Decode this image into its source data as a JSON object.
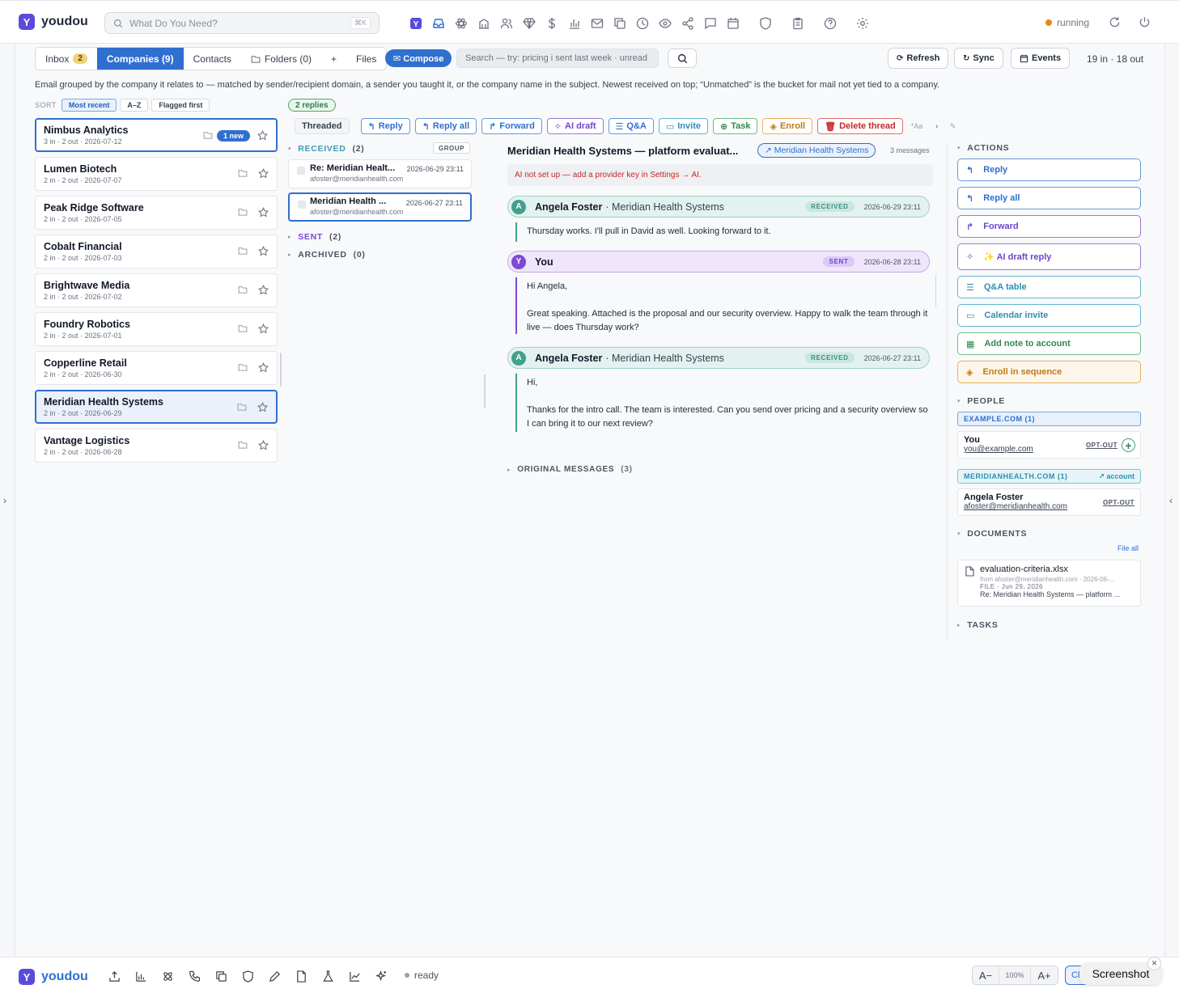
{
  "app": {
    "name": "youdou",
    "logo_letter": "Y"
  },
  "topbar": {
    "search_placeholder": "What Do You Need?",
    "search_shortcut": "⌘K",
    "status": "running",
    "icons": [
      "youdou-icon",
      "inbox-icon",
      "atom-icon",
      "building-icon",
      "users-icon",
      "gem-icon",
      "dollar-icon",
      "bar-chart-icon",
      "mail-icon",
      "copy-icon",
      "clock-icon",
      "eye-icon",
      "share-icon",
      "chat-icon",
      "calendar-icon",
      "shield-icon",
      "clipboard-icon",
      "help-icon",
      "gear-icon"
    ]
  },
  "tabs": [
    {
      "label": "Inbox",
      "badge": "2"
    },
    {
      "label": "Companies (9)"
    },
    {
      "label": "Contacts"
    },
    {
      "label": "Folders (0)"
    },
    {
      "label": "+"
    },
    {
      "label": "Files"
    }
  ],
  "compose_label": "✉ Compose",
  "mail_search_placeholder": "Search — try: pricing i sent last week · unread",
  "header_buttons": {
    "refresh": "Refresh",
    "sync": "Sync",
    "events": "Events"
  },
  "counts": "19 in · 18 out",
  "description": "Email grouped by the company it relates to — matched by sender/recipient domain, a sender you taught it, or the company name in the subject. Newest received on top; “Unmatched” is the bucket for mail not yet tied to a company.",
  "sort": {
    "label": "SORT",
    "options": [
      "Most recent",
      "A–Z",
      "Flagged first"
    ]
  },
  "companies": [
    {
      "name": "Nimbus Analytics",
      "meta": "3 in · 2 out · 2026-07-12",
      "badge": "1 new"
    },
    {
      "name": "Lumen Biotech",
      "meta": "2 in · 2 out · 2026-07-07"
    },
    {
      "name": "Peak Ridge Software",
      "meta": "2 in · 2 out · 2026-07-05"
    },
    {
      "name": "Cobalt Financial",
      "meta": "2 in · 2 out · 2026-07-03"
    },
    {
      "name": "Brightwave Media",
      "meta": "2 in · 2 out · 2026-07-02"
    },
    {
      "name": "Foundry Robotics",
      "meta": "2 in · 2 out · 2026-07-01"
    },
    {
      "name": "Copperline Retail",
      "meta": "2 in · 2 out · 2026-06-30"
    },
    {
      "name": "Meridian Health Systems",
      "meta": "2 in · 2 out · 2026-06-29"
    },
    {
      "name": "Vantage Logistics",
      "meta": "2 in · 2 out · 2026-06-28"
    }
  ],
  "thread_list": {
    "replies_badge": "2 replies",
    "actions": [
      "Threaded",
      "Reply",
      "Reply all",
      "Forward",
      "AI draft",
      "Q&A",
      "Invite",
      "Task",
      "Enroll",
      "Delete thread"
    ],
    "small_icons": [
      "*Aa",
      "◑",
      "✎"
    ],
    "received": {
      "label": "RECEIVED",
      "count": "(2)"
    },
    "group_label": "GROUP",
    "messages": [
      {
        "subject": "Re: Meridian Healt...",
        "date": "2026-06-29 23:11",
        "from": "afoster@meridianhealth.com"
      },
      {
        "subject": "Meridian Health ...",
        "date": "2026-06-27 23:11",
        "from": "afoster@meridianhealth.com"
      }
    ],
    "sent": {
      "label": "SENT",
      "count": "(2)"
    },
    "archived": {
      "label": "ARCHIVED",
      "count": "(0)"
    }
  },
  "thread": {
    "title": "Meridian Health Systems — platform evaluat...",
    "company_chip": "↗ Meridian Health Systems",
    "message_count": "3 messages",
    "ai_warning": "AI not set up — add a provider key in Settings → AI.",
    "messages": [
      {
        "avatar": "A",
        "name": "Angela Foster",
        "company": "· Meridian Health Systems",
        "tag": "RECEIVED",
        "date": "2026-06-29 23:11",
        "body": "Thursday works. I'll pull in David as well. Looking forward to it."
      },
      {
        "avatar": "Y",
        "name": "You",
        "company": "",
        "tag": "SENT",
        "date": "2026-06-28 23:11",
        "body": "Hi Angela,\n\nGreat speaking. Attached is the proposal and our security overview. Happy to walk the team through it live — does Thursday work?"
      },
      {
        "avatar": "A",
        "name": "Angela Foster",
        "company": "· Meridian Health Systems",
        "tag": "RECEIVED",
        "date": "2026-06-27 23:11",
        "body": "Hi,\n\nThanks for the intro call. The team is interested. Can you send over pricing and a security overview so I can bring it to our next review?"
      }
    ],
    "original": {
      "label": "ORIGINAL MESSAGES",
      "count": "(3)"
    }
  },
  "sidebar": {
    "actions_label": "ACTIONS",
    "actions": [
      "Reply",
      "Reply all",
      "Forward",
      "✨ AI draft reply",
      "Q&A table",
      "Calendar invite",
      "Add note to account",
      "Enroll in sequence"
    ],
    "people_label": "PEOPLE",
    "domains": [
      {
        "label": "EXAMPLE.COM (1)",
        "person": {
          "name": "You",
          "email": "you@example.com",
          "opt": "OPT-OUT"
        }
      },
      {
        "label": "MERIDIANHEALTH.COM (1)",
        "account": "↗ account",
        "person": {
          "name": "Angela Foster",
          "email": "afoster@meridianhealth.com",
          "opt": "OPT-OUT"
        }
      }
    ],
    "documents_label": "DOCUMENTS",
    "file_all": "File all",
    "document": {
      "name": "evaluation-criteria.xlsx",
      "from": "from afoster@meridianhealth.com · 2026-06-...",
      "type": "FILE · Jun 29, 2026",
      "subject": "Re: Meridian Health Systems — platform ..."
    },
    "tasks_label": "TASKS"
  },
  "bottombar": {
    "status": "ready",
    "zoom_minus": "A−",
    "zoom_value": "100%",
    "zoom_plus": "A+",
    "clip": "Cl",
    "screenshot": "Screenshot"
  }
}
